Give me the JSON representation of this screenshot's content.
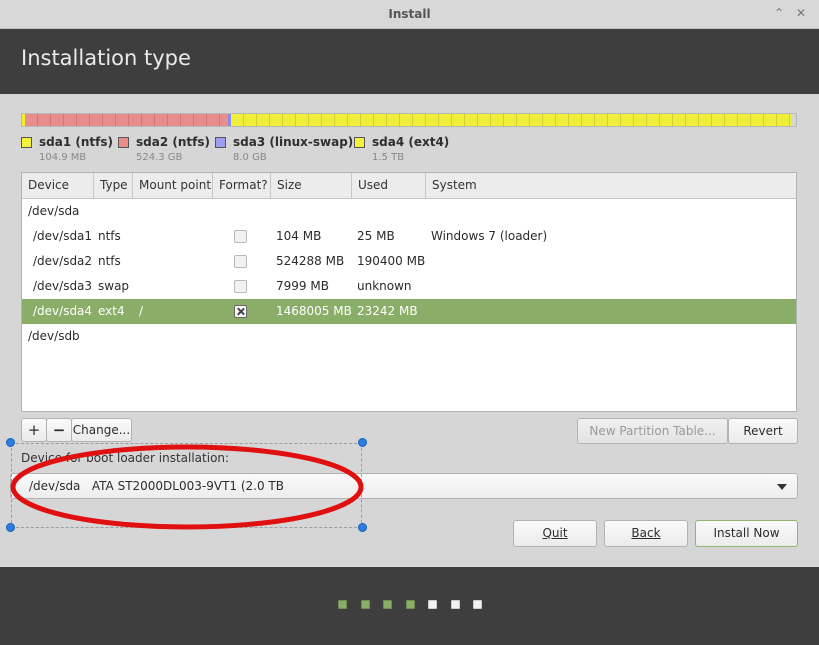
{
  "window": {
    "title": "Install",
    "buttons": [
      "⌃",
      "✕"
    ]
  },
  "header": {
    "title": "Installation type"
  },
  "partition_bar": {
    "segments": [
      {
        "name": "sda1",
        "fraction": 0.0001,
        "color": "#f2f02a"
      },
      {
        "name": "sda2",
        "fraction": 0.264,
        "color": "#e88c8c"
      },
      {
        "name": "sda3",
        "fraction": 0.005,
        "color": "#8c8ce8"
      },
      {
        "name": "sda4",
        "fraction": 0.731,
        "color": "#f0ef3c"
      }
    ]
  },
  "legend": [
    {
      "name": "sda1 (ntfs)",
      "size": "104.9 MB",
      "color": "#f5f23a"
    },
    {
      "name": "sda2 (ntfs)",
      "size": "524.3 GB",
      "color": "#e88c8c"
    },
    {
      "name": "sda3 (linux-swap)",
      "size": "8.0 GB",
      "color": "#9c9cf0"
    },
    {
      "name": "sda4 (ext4)",
      "size": "1.5 TB",
      "color": "#f5f23a"
    }
  ],
  "table": {
    "columns": [
      "Device",
      "Type",
      "Mount point",
      "Format?",
      "Size",
      "Used",
      "System"
    ],
    "rows": [
      {
        "device": "/dev/sda",
        "type": "",
        "mount": "",
        "format": null,
        "size": "",
        "used": "",
        "system": "",
        "kind": "disk"
      },
      {
        "device": "/dev/sda1",
        "type": "ntfs",
        "mount": "",
        "format": false,
        "size": "104 MB",
        "used": "25 MB",
        "system": "Windows 7 (loader)",
        "kind": "part"
      },
      {
        "device": "/dev/sda2",
        "type": "ntfs",
        "mount": "",
        "format": false,
        "size": "524288 MB",
        "used": "190400 MB",
        "system": "",
        "kind": "part"
      },
      {
        "device": "/dev/sda3",
        "type": "swap",
        "mount": "",
        "format": false,
        "size": "7999 MB",
        "used": "unknown",
        "system": "",
        "kind": "part"
      },
      {
        "device": "/dev/sda4",
        "type": "ext4",
        "mount": "/",
        "format": true,
        "size": "1468005 MB",
        "used": "23242 MB",
        "system": "",
        "kind": "part",
        "selected": true
      },
      {
        "device": "/dev/sdb",
        "type": "",
        "mount": "",
        "format": null,
        "size": "",
        "used": "",
        "system": "",
        "kind": "disk"
      }
    ]
  },
  "toolbar": {
    "add": "+",
    "remove": "−",
    "change": "Change...",
    "new_table": "New Partition Table...",
    "revert": "Revert"
  },
  "bootloader": {
    "label": "Device for boot loader installation:",
    "device": "/dev/sda",
    "model": "ATA ST2000DL003-9VT1 (2.0 TB"
  },
  "actions": {
    "quit": "Quit",
    "back": "Back",
    "install": "Install Now"
  },
  "progress": {
    "steps_total": 7,
    "steps_done": 4
  },
  "colors": {
    "accent": "#8aae68",
    "header": "#3e3e3e",
    "annotation": "#e01010"
  }
}
